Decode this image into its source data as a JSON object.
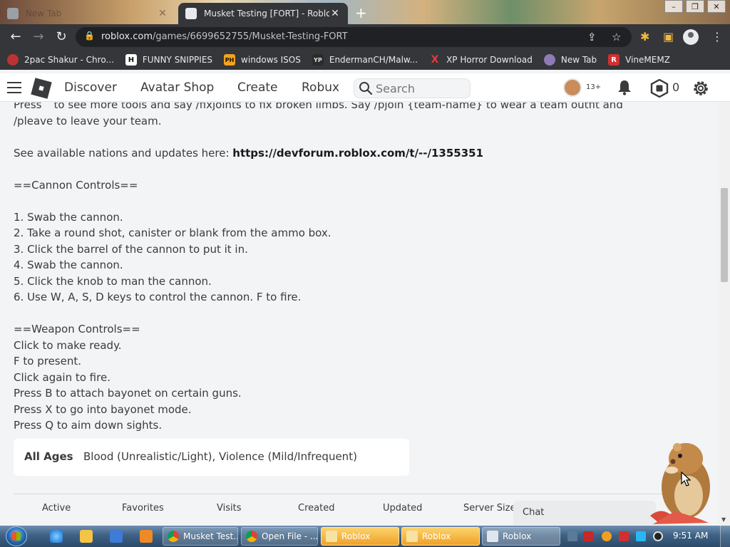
{
  "browser": {
    "tabs": [
      {
        "title": "New Tab",
        "active": false
      },
      {
        "title": "Musket Testing [FORT] - Roblox",
        "active": true
      }
    ],
    "url_host": "roblox.com",
    "url_path": "/games/6699652755/Musket-Testing-FORT",
    "bookmarks": [
      {
        "label": "2pac Shakur - Chro...",
        "icon": "tupac-favicon",
        "icon_bg": "#b33",
        "icon_text": ""
      },
      {
        "label": "FUNNY SNIPPIES",
        "icon": "h-favicon",
        "icon_bg": "#ffffff",
        "icon_text": "H"
      },
      {
        "label": "windows ISOS",
        "icon": "ph-favicon",
        "icon_bg": "#f7a21b",
        "icon_text": "PH"
      },
      {
        "label": "EndermanCH/Malw...",
        "icon": "yp-favicon",
        "icon_bg": "#2b2b2b",
        "icon_text": "YP"
      },
      {
        "label": "XP Horror Download",
        "icon": "x-favicon",
        "icon_bg": "#35363a",
        "icon_text": "X"
      },
      {
        "label": "New Tab",
        "icon": "globe-favicon",
        "icon_bg": "#8e7bb5",
        "icon_text": ""
      },
      {
        "label": "VineMEMZ",
        "icon": "r-favicon",
        "icon_bg": "#d32f2f",
        "icon_text": "R"
      }
    ]
  },
  "roblox_nav": {
    "links": [
      "Discover",
      "Avatar Shop",
      "Create",
      "Robux"
    ],
    "search_placeholder": "Search",
    "age_badge": "13+",
    "robux_balance": "0"
  },
  "description": {
    "intro_line1": "Press ` to see more tools and say /fixjoints to fix broken limbs. Say /pjoin {team-name} to wear a team outfit and",
    "intro_line2": "/pleave to leave your team.",
    "nations_prefix": "See available nations and updates here: ",
    "nations_link": "https://devforum.roblox.com/t/--/1355351",
    "cannon_heading": "==Cannon Controls==",
    "cannon_steps": [
      "1. Swab the cannon.",
      "2. Take a round shot, canister or blank from the ammo box.",
      "3. Click the barrel of the cannon to put it in.",
      "4. Swab the cannon.",
      "5. Click the knob to man the cannon.",
      "6. Use W, A, S, D keys to control the cannon. F to fire."
    ],
    "weapon_heading": "==Weapon Controls==",
    "weapon_steps": [
      "Click to make ready.",
      "F to present.",
      "Click again to fire.",
      "Press B to attach bayonet on certain guns.",
      "Press X to go into bayonet mode.",
      "Press Q to aim down sights."
    ]
  },
  "rating": {
    "age": "All Ages",
    "descriptors": "Blood (Unrealistic/Light), Violence (Mild/Infrequent)"
  },
  "stats_labels": [
    "Active",
    "Favorites",
    "Visits",
    "Created",
    "Updated",
    "Server Size"
  ],
  "chat_label": "Chat",
  "taskbar": {
    "tasks": [
      {
        "label": "Musket Test...",
        "kind": "chrome"
      },
      {
        "label": "Open File - ...",
        "kind": "chrome"
      },
      {
        "label": "Roblox",
        "kind": "roblox"
      },
      {
        "label": "Roblox",
        "kind": "roblox"
      },
      {
        "label": "Roblox",
        "kind": "roblox-light"
      }
    ],
    "clock": "9:51 AM"
  },
  "colors": {
    "roblox_text": "#393b3d",
    "chrome_dark": "#35363a",
    "page_bg": "#f2f4f5"
  }
}
